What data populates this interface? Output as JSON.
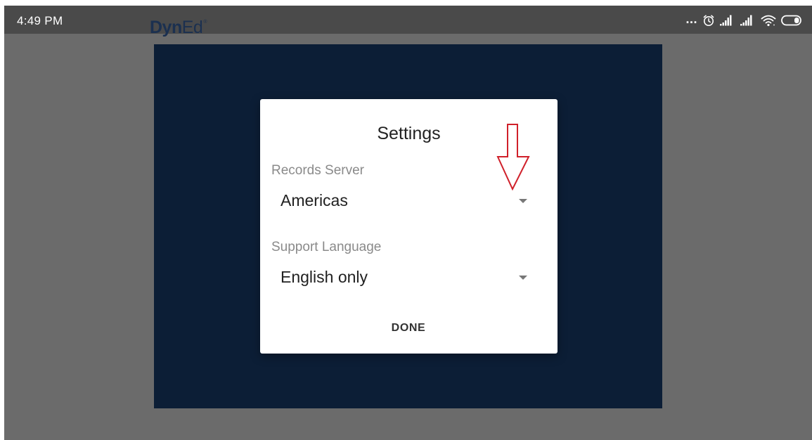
{
  "status_bar": {
    "time": "4:49 PM",
    "icons": [
      "more-dots-icon",
      "alarm-icon",
      "signal-icon",
      "signal-icon",
      "wifi-icon",
      "battery-icon"
    ],
    "dots": "..."
  },
  "app": {
    "logo_dyn": "Dyn",
    "logo_ed": "Ed",
    "logo_mark": "®"
  },
  "dialog": {
    "title": "Settings",
    "records_server": {
      "label": "Records Server",
      "value": "Americas"
    },
    "support_language": {
      "label": "Support Language",
      "value": "English only"
    },
    "done_label": "DONE"
  },
  "colors": {
    "background_gray": "#6b6b6b",
    "status_bar": "#4a4a4a",
    "app_panel_navy": "#0c1e36",
    "annotation_red": "#d0202a"
  }
}
